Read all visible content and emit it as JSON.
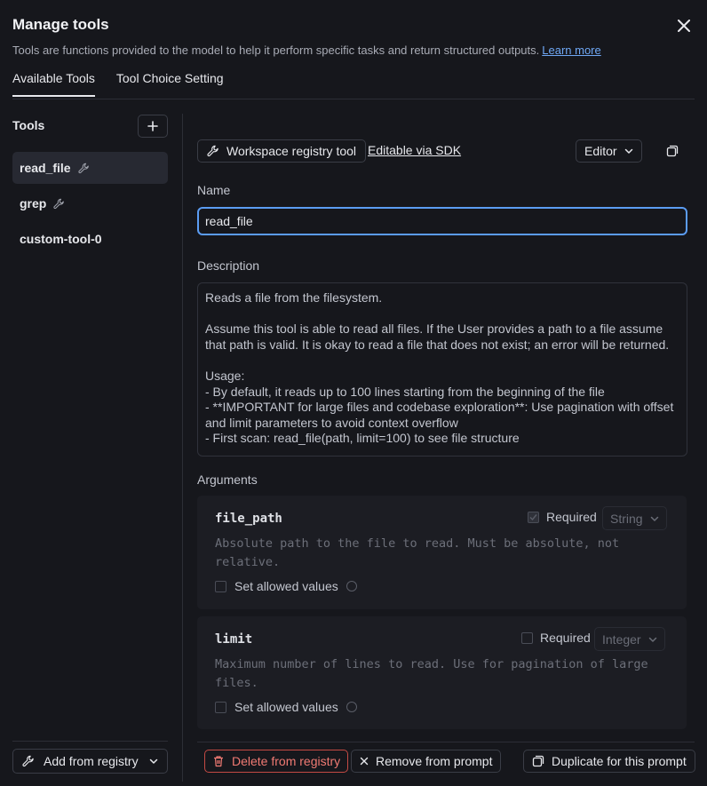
{
  "dialog": {
    "title": "Manage tools",
    "subtitle": "Tools are functions provided to the model to help it perform specific tasks and return structured outputs.",
    "learn_more": "Learn more",
    "close_icon": "close-icon"
  },
  "tabs": [
    {
      "label": "Available Tools",
      "active": true
    },
    {
      "label": "Tool Choice Setting",
      "active": false
    }
  ],
  "sidebar": {
    "title": "Tools",
    "items": [
      {
        "label": "read_file",
        "icon": "wrench-icon",
        "active": true
      },
      {
        "label": "grep",
        "icon": "wrench-icon",
        "active": false
      },
      {
        "label": "custom-tool-0",
        "active": false
      }
    ],
    "add_from_registry": "Add from registry"
  },
  "editor": {
    "badge": "Workspace registry tool",
    "sdk_link": "Editable via SDK",
    "mode": "Editor",
    "name_label": "Name",
    "name_value": "read_file",
    "description_label": "Description",
    "description": "Reads a file from the filesystem.\n\nAssume this tool is able to read all files. If the User provides a path to a file assume that path is valid. It is okay to read a file that does not exist; an error will be returned.\n\nUsage:\n- By default, it reads up to 100 lines starting from the beginning of the file\n- **IMPORTANT for large files and codebase exploration**: Use pagination with offset and limit parameters to avoid context overflow\n- First scan: read_file(path, limit=100) to see file structure",
    "arguments_label": "Arguments",
    "arguments": [
      {
        "name": "file_path",
        "required_label": "Required",
        "required": true,
        "type": "String",
        "description": "Absolute path to the file to read. Must be absolute, not relative.",
        "allowed_label": "Set allowed values"
      },
      {
        "name": "limit",
        "required_label": "Required",
        "required": false,
        "type": "Integer",
        "description": "Maximum number of lines to read. Use for pagination of large files.",
        "allowed_label": "Set allowed values"
      }
    ]
  },
  "footer": {
    "delete": "Delete from registry",
    "remove": "Remove from prompt",
    "duplicate": "Duplicate for this prompt"
  },
  "colors": {
    "background": "#16171c",
    "accent_blue": "#5b9cf2",
    "danger": "#f07a73"
  }
}
